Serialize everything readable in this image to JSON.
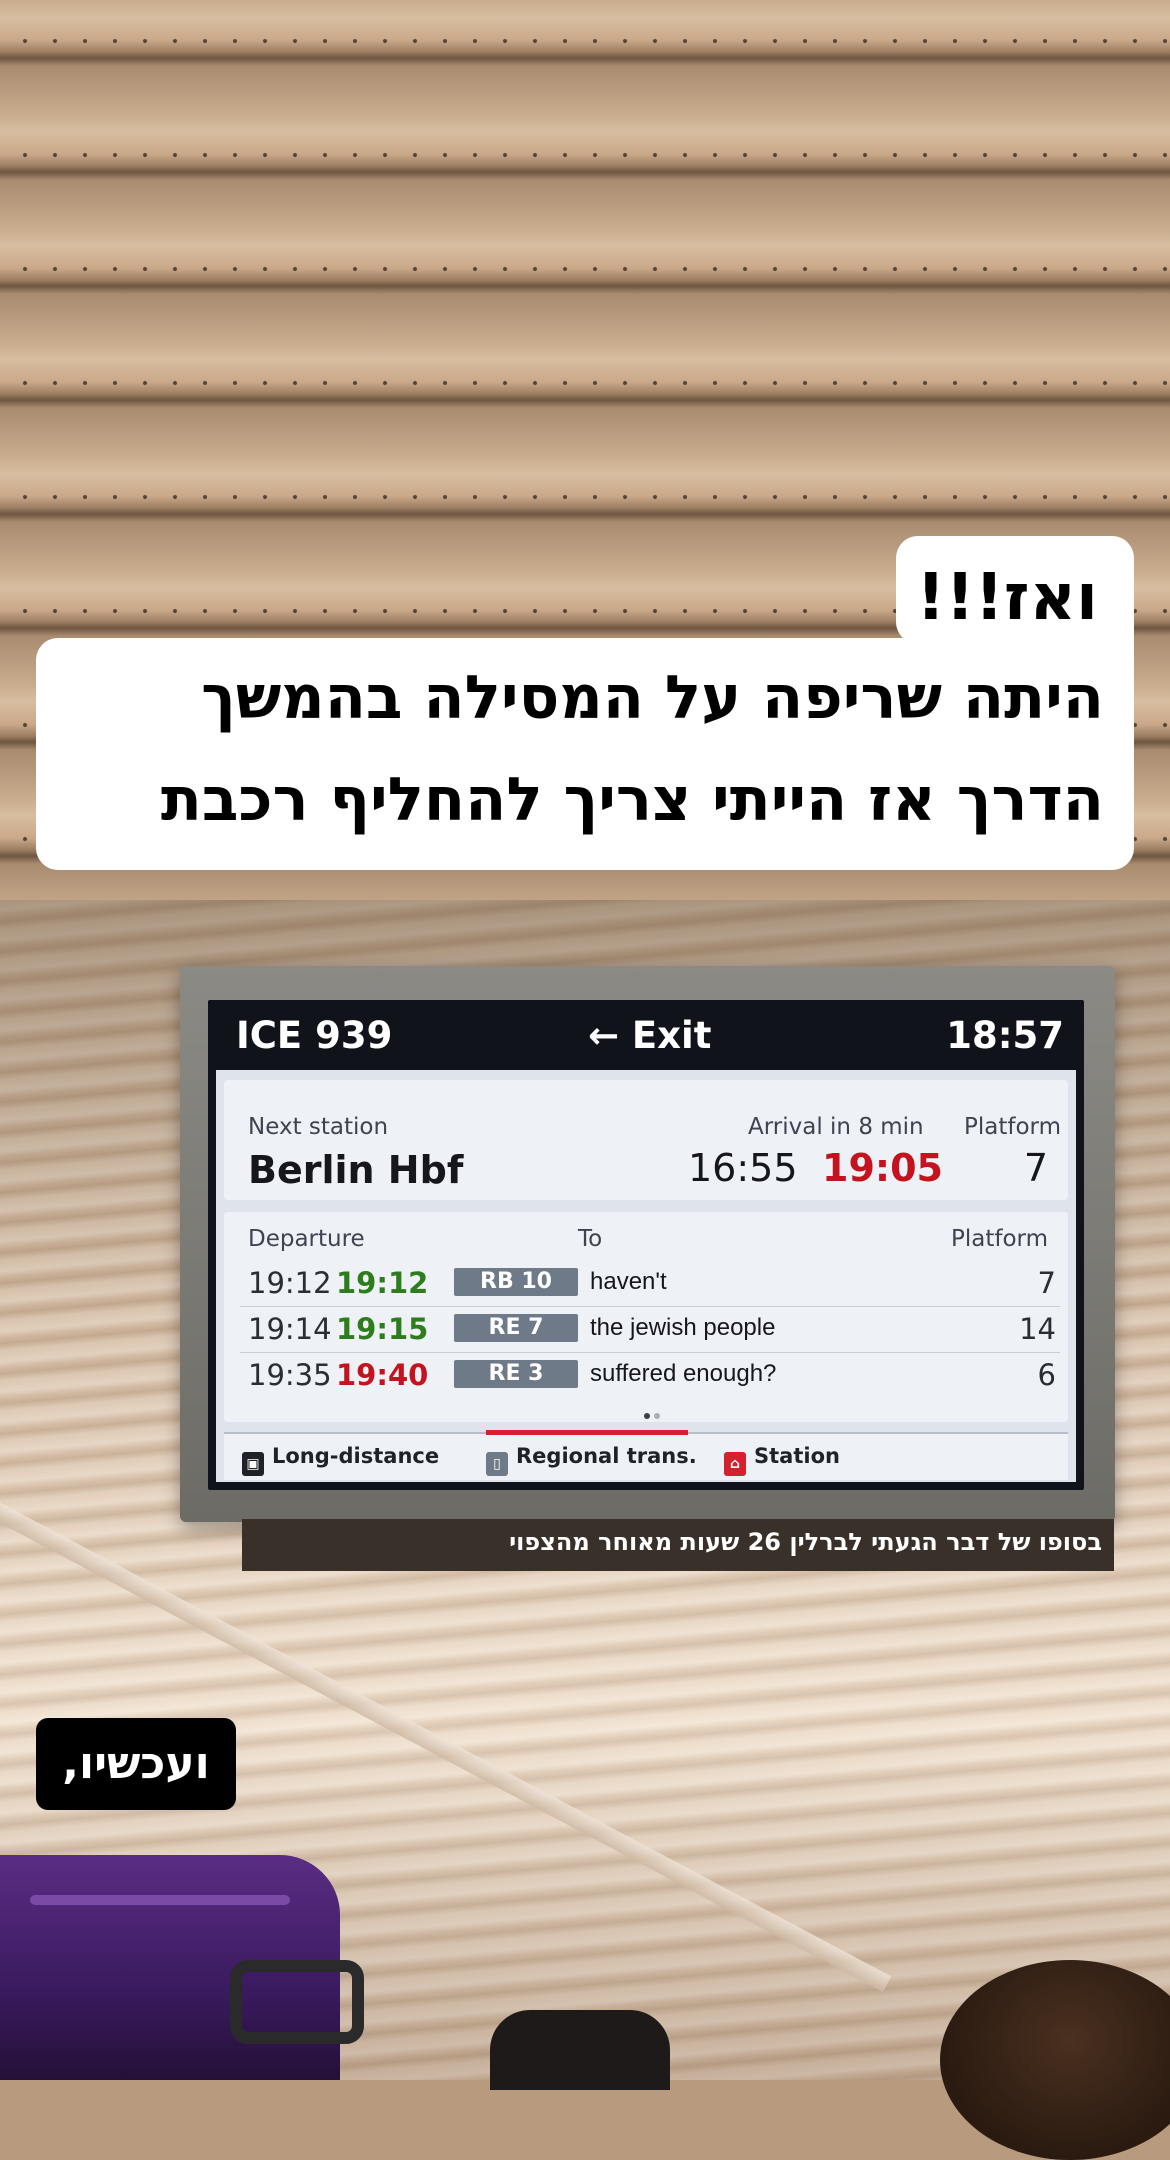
{
  "captions": {
    "intro": "ואז!!!",
    "line1": "היתה שריפה על המסילה בהמשך",
    "line2": "הדרך אז הייתי צריך להחליף רכבת",
    "small": "בסופו של דבר הגעתי לברלין 26 שעות מאוחר מהצפוי",
    "now": "ועכשיו,"
  },
  "display": {
    "train_number": "ICE 939",
    "exit_label": "← Exit",
    "clock": "18:57",
    "next": {
      "label": "Next station",
      "station": "Berlin Hbf",
      "arrival_label": "Arrival in 8 min",
      "scheduled": "16:55",
      "actual": "19:05",
      "platform_label": "Platform",
      "platform": "7"
    },
    "departures": {
      "departure_label": "Departure",
      "to_label": "To",
      "platform_label": "Platform",
      "rows": [
        {
          "scheduled": "19:12",
          "actual": "19:12",
          "status": "ontime",
          "line": "RB 10",
          "destination": "haven't",
          "platform": "7"
        },
        {
          "scheduled": "19:14",
          "actual": "19:15",
          "status": "ontime",
          "line": "RE 7",
          "destination": "the jewish people",
          "platform": "14"
        },
        {
          "scheduled": "19:35",
          "actual": "19:40",
          "status": "late",
          "line": "RE 3",
          "destination": "suffered enough?",
          "platform": "6"
        }
      ]
    },
    "legend": {
      "long_distance": "Long-distance",
      "regional": "Regional trans.",
      "station": "Station"
    }
  },
  "colors": {
    "delay_red": "#c4131f",
    "ontime_green": "#2e7d1d",
    "db_red": "#d5202e"
  }
}
